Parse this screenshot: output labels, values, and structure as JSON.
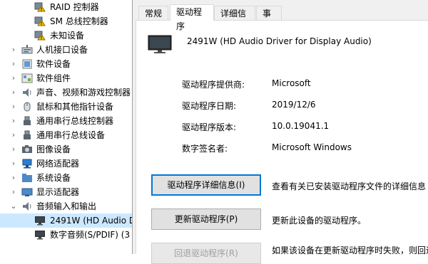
{
  "tree": {
    "items": [
      {
        "label": "RAID 控制器",
        "indent": 2,
        "icon": "warning-device-icon",
        "chevron": ""
      },
      {
        "label": "SM 总线控制器",
        "indent": 2,
        "icon": "warning-device-icon",
        "chevron": ""
      },
      {
        "label": "未知设备",
        "indent": 2,
        "icon": "warning-device-icon",
        "chevron": ""
      },
      {
        "label": "人机接口设备",
        "indent": 1,
        "icon": "hid-icon",
        "chevron": "›"
      },
      {
        "label": "软件设备",
        "indent": 1,
        "icon": "software-device-icon",
        "chevron": "›"
      },
      {
        "label": "软件组件",
        "indent": 1,
        "icon": "software-component-icon",
        "chevron": "›"
      },
      {
        "label": "声音、视频和游戏控制器",
        "indent": 1,
        "icon": "speaker-icon",
        "chevron": "›"
      },
      {
        "label": "鼠标和其他指针设备",
        "indent": 1,
        "icon": "mouse-icon",
        "chevron": "›"
      },
      {
        "label": "通用串行总线控制器",
        "indent": 1,
        "icon": "usb-icon",
        "chevron": "›"
      },
      {
        "label": "通用串行总线设备",
        "indent": 1,
        "icon": "usb-icon",
        "chevron": "›"
      },
      {
        "label": "图像设备",
        "indent": 1,
        "icon": "camera-icon",
        "chevron": "›"
      },
      {
        "label": "网络适配器",
        "indent": 1,
        "icon": "network-icon",
        "chevron": "›"
      },
      {
        "label": "系统设备",
        "indent": 1,
        "icon": "system-folder-icon",
        "chevron": "›"
      },
      {
        "label": "显示适配器",
        "indent": 1,
        "icon": "display-adapter-icon",
        "chevron": "›"
      },
      {
        "label": "音频输入和输出",
        "indent": 1,
        "icon": "audio-io-icon",
        "chevron": "⌄"
      },
      {
        "label": "2491W (HD Audio D",
        "indent": 2,
        "icon": "monitor-icon",
        "chevron": "",
        "selected": true
      },
      {
        "label": "数字音频(S/PDIF) (3",
        "indent": 2,
        "icon": "monitor-icon",
        "chevron": ""
      }
    ]
  },
  "dialog": {
    "tabs": [
      {
        "label": "常规",
        "active": false
      },
      {
        "label": "驱动程序",
        "active": true
      },
      {
        "label": "详细信息",
        "active": false
      },
      {
        "label": "事件",
        "active": false
      }
    ],
    "device_name": "2491W (HD Audio Driver for Display Audio)",
    "info": [
      {
        "label": "驱动程序提供商:",
        "value": "Microsoft"
      },
      {
        "label": "驱动程序日期:",
        "value": "2019/12/6"
      },
      {
        "label": "驱动程序版本:",
        "value": "10.0.19041.1"
      },
      {
        "label": "数字签名者:",
        "value": "Microsoft Windows"
      }
    ],
    "buttons": [
      {
        "label": "驱动程序详细信息(I)",
        "desc": "查看有关已安装驱动程序文件的详细信息",
        "state": "focus"
      },
      {
        "label": "更新驱动程序(P)",
        "desc": "更新此设备的驱动程序。",
        "state": "normal"
      },
      {
        "label": "回退驱动程序(R)",
        "desc": "如果该设备在更新驱动程序时失败，则回退",
        "state": "disabled"
      }
    ]
  },
  "colors": {
    "selection": "#cce8ff",
    "focus_border": "#0078d7",
    "dialog_bg": "#f0f0f0"
  }
}
